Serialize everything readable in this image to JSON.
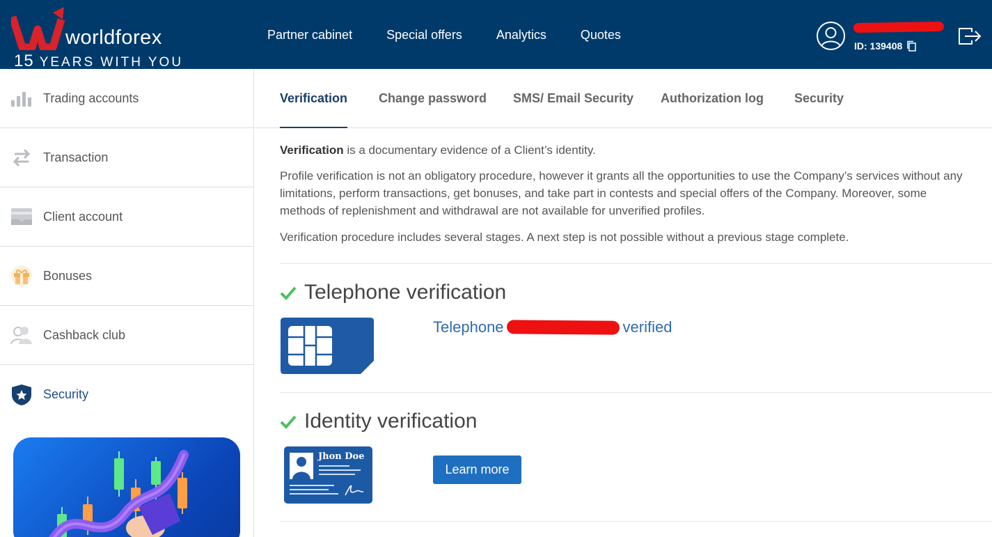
{
  "brand": {
    "name": "worldforex",
    "years_number": "15",
    "years_text": "YEARS WITH YOU",
    "logo_letter": "W"
  },
  "header": {
    "nav": [
      "Partner cabinet",
      "Special offers",
      "Analytics",
      "Quotes"
    ],
    "user_id": "ID: 139408",
    "colors": {
      "background": "#003a6b",
      "redaction": "#ee1111"
    }
  },
  "sidebar": {
    "items": [
      {
        "label": "Trading accounts",
        "icon": "bar-chart-icon"
      },
      {
        "label": "Transaction",
        "icon": "transfer-arrows-icon"
      },
      {
        "label": "Client account",
        "icon": "wallet-icon"
      },
      {
        "label": "Bonuses",
        "icon": "gift-icon"
      },
      {
        "label": "Cashback club",
        "icon": "users-icon"
      },
      {
        "label": "Security",
        "icon": "shield-star-icon",
        "active": true
      }
    ]
  },
  "tabs": [
    {
      "label": "Verification",
      "active": true
    },
    {
      "label": "Change password"
    },
    {
      "label": "SMS/ Email Security"
    },
    {
      "label": "Authorization log"
    },
    {
      "label": "Security"
    }
  ],
  "intro": {
    "lead_bold": "Verification",
    "lead_rest": " is a documentary evidence of a Client’s identity.",
    "p2": "Profile verification is not an obligatory procedure, however it grants all the opportunities to use the Company’s services without any limitations, perform transactions, get bonuses, and take part in contests and special offers of the Company. Moreover, some methods of replenishment and withdrawal are not available for unverified profiles.",
    "p3": "Verification procedure includes several stages. A next step is not possible without a previous stage complete."
  },
  "telephone": {
    "title": "Telephone verification",
    "status_prefix": "Telephone",
    "status_suffix": "verified"
  },
  "identity": {
    "title": "Identity verification",
    "card_name": "Jhon Doe",
    "button": "Learn more"
  }
}
